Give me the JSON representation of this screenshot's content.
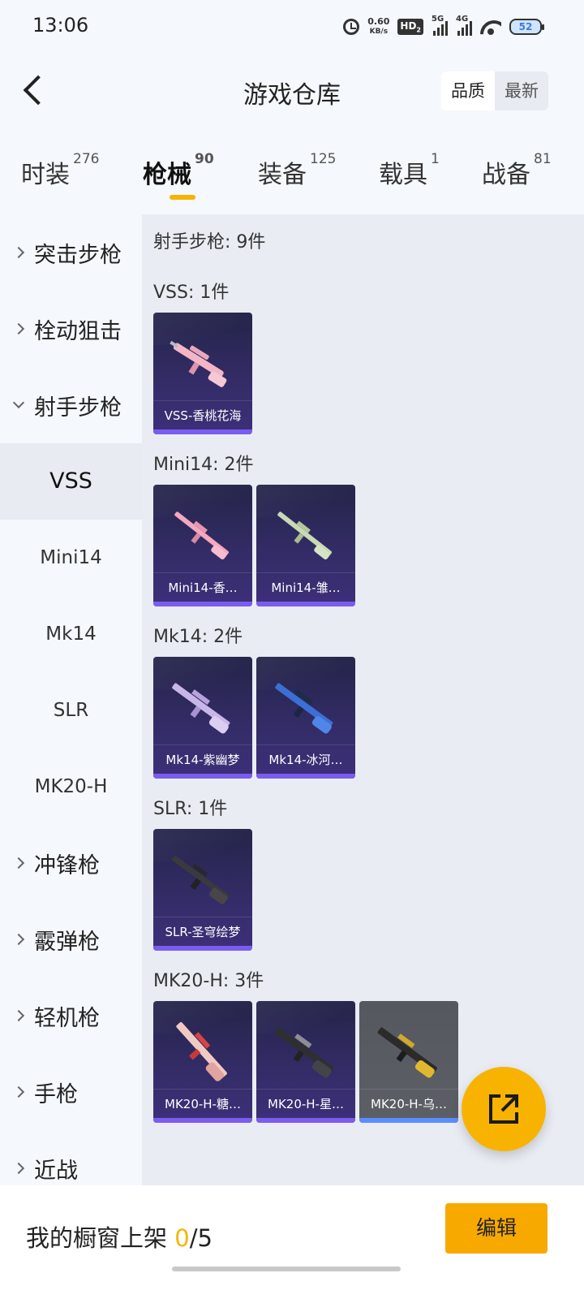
{
  "status_bar": {
    "time": "13:06",
    "net_speed_value": "0.60",
    "net_speed_unit": "KB/s",
    "hd_label": "HD",
    "hd_sub": "2",
    "signal1_label": "5G",
    "signal2_label": "4G",
    "battery": "52"
  },
  "header": {
    "title": "游戏仓库",
    "sort_options": [
      "品质",
      "最新"
    ],
    "active_sort": "品质"
  },
  "tabs": [
    {
      "label": "时装",
      "count": "276"
    },
    {
      "label": "枪械",
      "count": "90"
    },
    {
      "label": "装备",
      "count": "125"
    },
    {
      "label": "载具",
      "count": "1"
    },
    {
      "label": "战备",
      "count": "81"
    }
  ],
  "active_tab": "枪械",
  "sidebar": {
    "categories_top": [
      "突击步枪",
      "栓动狙击",
      "射手步枪"
    ],
    "expanded": "射手步枪",
    "subitems": [
      "VSS",
      "Mini14",
      "Mk14",
      "SLR",
      "MK20-H"
    ],
    "active_subitem": "VSS",
    "categories_bottom": [
      "冲锋枪",
      "霰弹枪",
      "轻机枪",
      "手枪",
      "近战"
    ]
  },
  "content": {
    "summary": "射手步枪: 9件",
    "groups": [
      {
        "header": "VSS: 1件",
        "items": [
          "VSS-香桃花海"
        ]
      },
      {
        "header": "Mini14: 2件",
        "items": [
          "Mini14-香…",
          "Mini14-雏…"
        ]
      },
      {
        "header": "Mk14: 2件",
        "items": [
          "Mk14-紫幽梦",
          "Mk14-冰河…"
        ]
      },
      {
        "header": "SLR: 1件",
        "items": [
          "SLR-圣穹绘梦"
        ]
      },
      {
        "header": "MK20-H: 3件",
        "items": [
          "MK20-H-糖…",
          "MK20-H-星…",
          "MK20-H-乌…"
        ]
      }
    ]
  },
  "bottom_bar": {
    "showcase_label": "我的橱窗上架",
    "showcase_current": "0",
    "showcase_total": "/5",
    "edit_label": "编辑"
  },
  "icons": {
    "back": "back-arrow-icon",
    "fab": "share-external-icon",
    "expand": "chevron-icon"
  },
  "colors": {
    "accent": "#f6b400",
    "card_bg": "#2e2a5c",
    "card_bar": "#7b5cf0"
  }
}
